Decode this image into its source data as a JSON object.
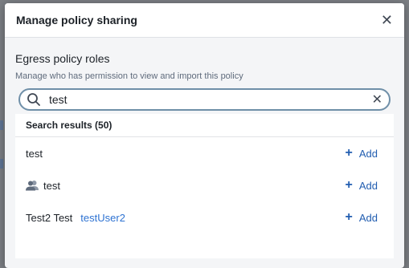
{
  "dialog": {
    "title": "Manage policy sharing",
    "close_icon": "close-icon"
  },
  "section": {
    "title": "Egress policy roles",
    "subtitle": "Manage who has permission to view and import this policy"
  },
  "search": {
    "value": "test",
    "search_icon": "search-icon",
    "clear_icon": "clear-icon"
  },
  "results": {
    "header": "Search results (50)",
    "items": [
      {
        "name": "test",
        "secondary": "",
        "icon": "",
        "action": "Add"
      },
      {
        "name": "test",
        "secondary": "",
        "icon": "group-icon",
        "action": "Add"
      },
      {
        "name": "Test2 Test",
        "secondary": "testUser2",
        "icon": "",
        "action": "Add"
      }
    ]
  }
}
